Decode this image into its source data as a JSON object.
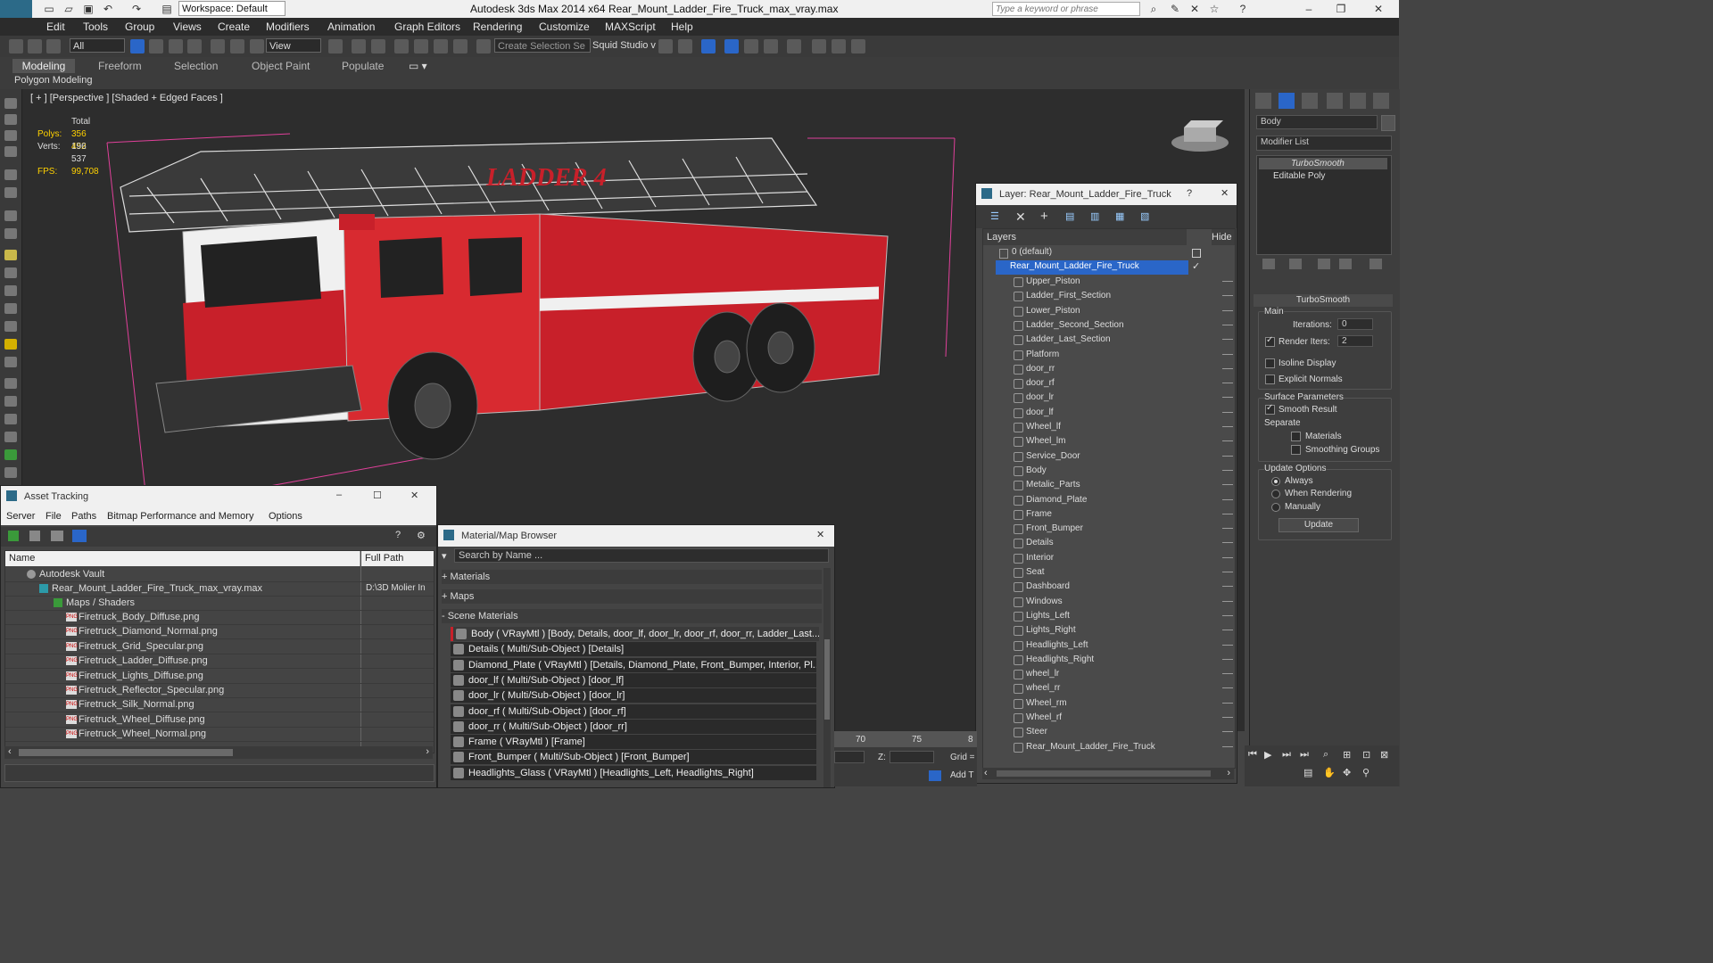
{
  "titlebar": {
    "workspace": "Workspace: Default",
    "app": "Autodesk 3ds Max  2014 x64",
    "file": "Rear_Mount_Ladder_Fire_Truck_max_vray.max",
    "search_placeholder": "Type a keyword or phrase"
  },
  "menu": [
    "Edit",
    "Tools",
    "Group",
    "Views",
    "Create",
    "Modifiers",
    "Animation",
    "Graph Editors",
    "Rendering",
    "Customize",
    "MAXScript",
    "Help"
  ],
  "toolbar": {
    "filter": "All",
    "refcoord": "View",
    "selset": "Create Selection Se",
    "studio": "Squid Studio v"
  },
  "ribbon": {
    "tabs": [
      "Modeling",
      "Freeform",
      "Selection",
      "Object Paint",
      "Populate"
    ],
    "sub": "Polygon Modeling"
  },
  "viewport": {
    "label": "[ + ] [Perspective ] [Shaded + Edged Faces ]",
    "stats": {
      "total": "Total",
      "polys_label": "Polys:",
      "polys": "356 452",
      "verts_label": "Verts:",
      "verts": "196 537",
      "fps_label": "FPS:",
      "fps": "99,708"
    },
    "truck_text": "LADDER 4"
  },
  "cmdpanel": {
    "object_name": "Body",
    "modifier_list": "Modifier List",
    "stack": [
      "TurboSmooth",
      "Editable Poly"
    ],
    "rollout": "TurboSmooth",
    "main": "Main",
    "iterations_label": "Iterations:",
    "iterations": "0",
    "render_iters_label": "Render Iters:",
    "render_iters": "2",
    "isoline": "Isoline Display",
    "explicit": "Explicit Normals",
    "surface": "Surface Parameters",
    "smooth": "Smooth Result",
    "separate": "Separate",
    "materials": "Materials",
    "smoothing": "Smoothing Groups",
    "update_options": "Update Options",
    "always": "Always",
    "when_rendering": "When Rendering",
    "manually": "Manually",
    "update": "Update"
  },
  "layer": {
    "title": "Layer: Rear_Mount_Ladder_Fire_Truck",
    "col_layers": "Layers",
    "col_hide": "Hide",
    "default": "0 (default)",
    "selected": "Rear_Mount_Ladder_Fire_Truck",
    "items": [
      "Upper_Piston",
      "Ladder_First_Section",
      "Lower_Piston",
      "Ladder_Second_Section",
      "Ladder_Last_Section",
      "Platform",
      "door_rr",
      "door_rf",
      "door_lr",
      "door_lf",
      "Wheel_lf",
      "Wheel_lm",
      "Service_Door",
      "Body",
      "Metalic_Parts",
      "Diamond_Plate",
      "Frame",
      "Front_Bumper",
      "Details",
      "Interior",
      "Seat",
      "Dashboard",
      "Windows",
      "Lights_Left",
      "Lights_Right",
      "Headlights_Left",
      "Headlights_Right",
      "wheel_lr",
      "wheel_rr",
      "Wheel_rm",
      "Wheel_rf",
      "Steer",
      "Rear_Mount_Ladder_Fire_Truck"
    ]
  },
  "asset": {
    "title": "Asset Tracking",
    "menu": [
      "Server",
      "File",
      "Paths",
      "Bitmap Performance and Memory",
      "Options"
    ],
    "col_name": "Name",
    "col_path": "Full Path",
    "vault": "Autodesk Vault",
    "file": "Rear_Mount_Ladder_Fire_Truck_max_vray.max",
    "file_path": "D:\\3D Molier In",
    "maps": "Maps / Shaders",
    "files": [
      "Firetruck_Body_Diffuse.png",
      "Firetruck_Diamond_Normal.png",
      "Firetruck_Grid_Specular.png",
      "Firetruck_Ladder_Diffuse.png",
      "Firetruck_Lights_Diffuse.png",
      "Firetruck_Reflector_Specular.png",
      "Firetruck_Silk_Normal.png",
      "Firetruck_Wheel_Diffuse.png",
      "Firetruck_Wheel_Normal.png"
    ]
  },
  "matbrowser": {
    "title": "Material/Map Browser",
    "search": "Search by Name ...",
    "sections": [
      "+ Materials",
      "+ Maps",
      "- Scene Materials"
    ],
    "rows": [
      "Body  ( VRayMtl ) [Body, Details, door_lf, door_lr, door_rf, door_rr, Ladder_Last...",
      "Details  ( Multi/Sub-Object ) [Details]",
      "Diamond_Plate  ( VRayMtl ) [Details, Diamond_Plate, Front_Bumper, Interior, Pl...",
      "door_lf  ( Multi/Sub-Object ) [door_lf]",
      "door_lr  ( Multi/Sub-Object ) [door_lr]",
      "door_rf  ( Multi/Sub-Object ) [door_rf]",
      "door_rr  ( Multi/Sub-Object ) [door_rr]",
      "Frame  ( VRayMtl ) [Frame]",
      "Front_Bumper  ( Multi/Sub-Object ) [Front_Bumper]",
      "Headlights_Glass  ( VRayMtl ) [Headlights_Left, Headlights_Right]"
    ]
  },
  "timeline": {
    "t70": "70",
    "t75": "75",
    "t8": "8",
    "z": "Z:",
    "grid": "Grid =",
    "addt": "Add T"
  },
  "colors": {
    "accent": "#2a66c8",
    "truck_red": "#c8202a",
    "stats_yellow": "#ffd100"
  }
}
